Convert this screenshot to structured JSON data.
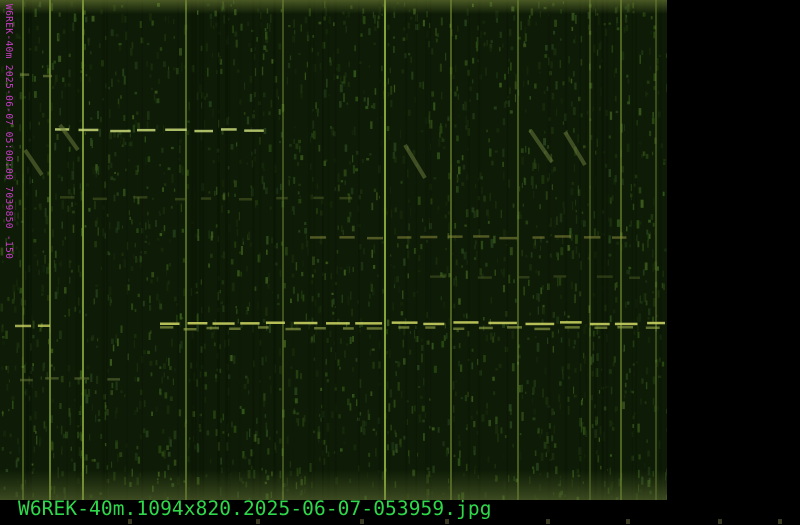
{
  "image": {
    "side_label": "W6REK-40m 2025-06-07 05:00:00 7039850 -150",
    "caption": "W6REK-40m.1094x820.2025-06-07-053959.jpg"
  },
  "colors": {
    "background": "#0d1a06",
    "signal": "#a8c84a",
    "side_label": "#c83cc8",
    "caption": "#2fd84a"
  }
}
